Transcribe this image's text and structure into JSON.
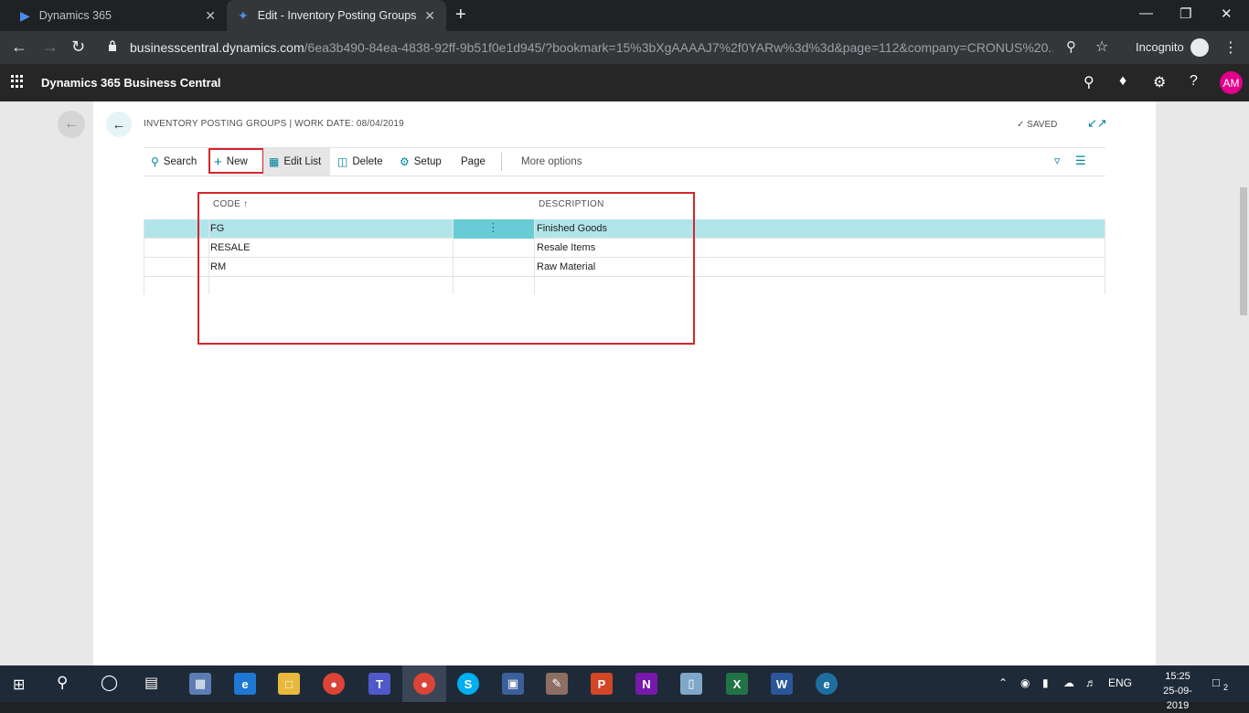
{
  "browser": {
    "tabs": [
      {
        "title": "Dynamics 365"
      },
      {
        "title": "Edit - Inventory Posting Groups -"
      }
    ],
    "url_host": "businesscentral.dynamics.com",
    "url_path": "/6ea3b490-84ea-4838-92ff-9b51f0e1d945/?bookmark=15%3bXgAAAAJ7%2f0YARw%3d%3d&page=112&company=CRONUS%20...",
    "profile_label": "Incognito"
  },
  "appbar": {
    "title": "Dynamics 365 Business Central",
    "avatar_initials": "AM"
  },
  "page": {
    "caption": "INVENTORY POSTING GROUPS | WORK DATE: 08/04/2019",
    "saved_label": "SAVED"
  },
  "actions": {
    "search": "Search",
    "new": "New",
    "edit_list": "Edit List",
    "delete": "Delete",
    "setup": "Setup",
    "page": "Page",
    "more_options": "More options"
  },
  "grid": {
    "columns": [
      "CODE ↑",
      "DESCRIPTION"
    ],
    "rows": [
      {
        "code": "FG",
        "description": "Finished Goods",
        "selected": true
      },
      {
        "code": "RESALE",
        "description": "Resale Items",
        "selected": false
      },
      {
        "code": "RM",
        "description": "Raw Material",
        "selected": false
      }
    ]
  },
  "taskbar": {
    "language": "ENG",
    "time": "15:25",
    "date": "25-09-2019",
    "notification_count": "2"
  },
  "colors": {
    "accent": "#00829b",
    "selected_row": "#b2e5ea",
    "highlight_box": "#d3262c",
    "avatar": "#e3008c"
  }
}
